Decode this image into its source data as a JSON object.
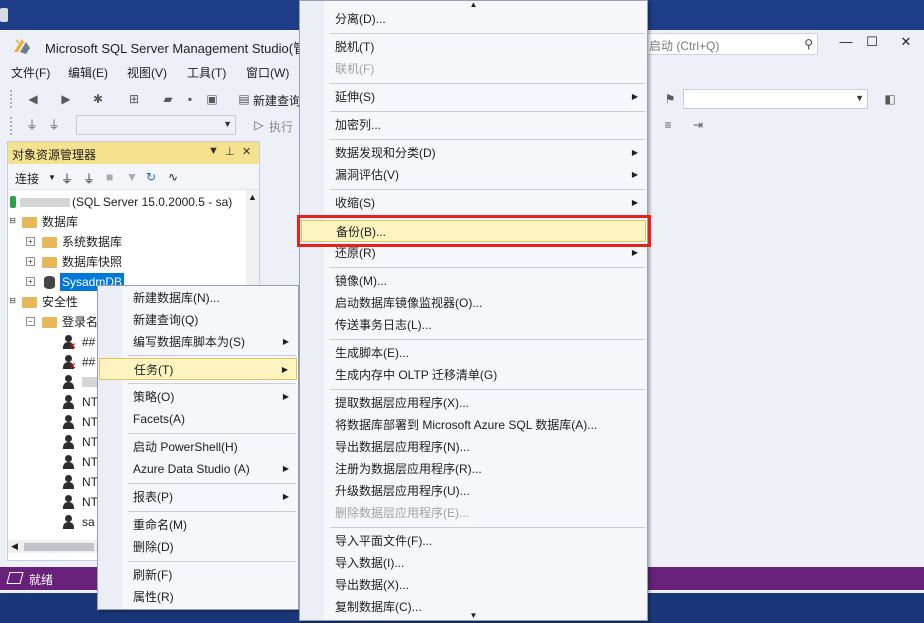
{
  "window": {
    "title": "Microsoft SQL Server Management Studio(管",
    "quick_launch_placeholder": "启动 (Ctrl+Q)",
    "minimize": "—",
    "maximize": "☐",
    "close": "✕"
  },
  "menubar": [
    "文件(F)",
    "编辑(E)",
    "视图(V)",
    "工具(T)",
    "窗口(W)"
  ],
  "toolbar": {
    "new_query": "新建查询",
    "execute": "执行"
  },
  "object_explorer": {
    "title": "对象资源管理器",
    "connect": "连接",
    "server": "(SQL Server 15.0.2000.5 - sa)",
    "databases": "数据库",
    "system_databases": "系统数据库",
    "db_snapshots": "数据库快照",
    "selected_db": "SysadmDB",
    "security": "安全性",
    "logins": "登录名",
    "login_items": [
      "##",
      "##",
      "",
      "NT",
      "NT",
      "NT",
      "NT",
      "NT",
      "NT",
      "sa"
    ]
  },
  "status": {
    "text": "就绪"
  },
  "context_menu_1": [
    {
      "label": "新建数据库(N)...",
      "sub": false
    },
    {
      "label": "新建查询(Q)",
      "sub": false
    },
    {
      "label": "编写数据库脚本为(S)",
      "sub": true
    },
    {
      "label": "任务(T)",
      "sub": true,
      "selected": true
    },
    {
      "label": "策略(O)",
      "sub": true
    },
    {
      "label": "Facets(A)",
      "sub": false
    },
    {
      "label": "启动 PowerShell(H)",
      "sub": false
    },
    {
      "label": "Azure Data Studio (A)",
      "sub": true
    },
    {
      "label": "报表(P)",
      "sub": true
    },
    {
      "label": "重命名(M)",
      "sub": false
    },
    {
      "label": "删除(D)",
      "sub": false
    },
    {
      "label": "刷新(F)",
      "sub": false
    },
    {
      "label": "属性(R)",
      "sub": false
    }
  ],
  "context_menu_2": [
    {
      "label": "分离(D)...",
      "sub": false
    },
    {
      "label": "脱机(T)",
      "sub": false
    },
    {
      "label": "联机(F)",
      "sub": false,
      "disabled": true
    },
    {
      "label": "延伸(S)",
      "sub": true
    },
    {
      "label": "加密列...",
      "sub": false
    },
    {
      "label": "数据发现和分类(D)",
      "sub": true
    },
    {
      "label": "漏洞评估(V)",
      "sub": true
    },
    {
      "label": "收缩(S)",
      "sub": true
    },
    {
      "label": "备份(B)...",
      "sub": false,
      "selected": true
    },
    {
      "label": "还原(R)",
      "sub": true
    },
    {
      "label": "镜像(M)...",
      "sub": false
    },
    {
      "label": "启动数据库镜像监视器(O)...",
      "sub": false
    },
    {
      "label": "传送事务日志(L)...",
      "sub": false
    },
    {
      "label": "生成脚本(E)...",
      "sub": false
    },
    {
      "label": "生成内存中 OLTP 迁移清单(G)",
      "sub": false
    },
    {
      "label": "提取数据层应用程序(X)...",
      "sub": false
    },
    {
      "label": "将数据库部署到 Microsoft Azure SQL 数据库(A)...",
      "sub": false
    },
    {
      "label": "导出数据层应用程序(N)...",
      "sub": false
    },
    {
      "label": "注册为数据层应用程序(R)...",
      "sub": false
    },
    {
      "label": "升级数据层应用程序(U)...",
      "sub": false
    },
    {
      "label": "删除数据层应用程序(E)...",
      "sub": false,
      "disabled": true
    },
    {
      "label": "导入平面文件(F)...",
      "sub": false
    },
    {
      "label": "导入数据(I)...",
      "sub": false
    },
    {
      "label": "导出数据(X)...",
      "sub": false
    },
    {
      "label": "复制数据库(C)...",
      "sub": false
    }
  ],
  "colors": {
    "status_bar": "#68217a",
    "highlight": "#fdf4bf",
    "red_box": "#e5221b"
  }
}
